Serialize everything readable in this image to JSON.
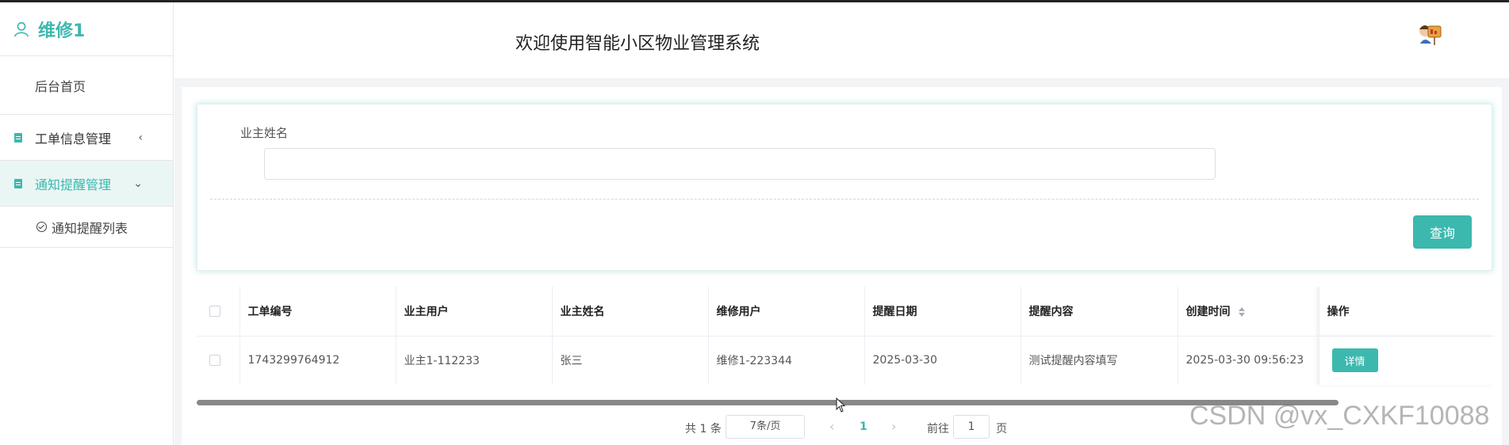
{
  "sidebar": {
    "username": "维修1",
    "items": [
      {
        "label": "后台首页"
      },
      {
        "label": "工单信息管理",
        "arrow": "‹"
      },
      {
        "label": "通知提醒管理",
        "arrow": "⌄"
      }
    ],
    "subitems": [
      {
        "label": "通知提醒列表"
      }
    ]
  },
  "header": {
    "title": "欢迎使用智能小区物业管理系统"
  },
  "search": {
    "label": "业主姓名",
    "value": "",
    "button": "查询"
  },
  "table": {
    "columns": [
      "工单编号",
      "业主用户",
      "业主姓名",
      "维修用户",
      "提醒日期",
      "提醒内容",
      "创建时间",
      "操作"
    ],
    "rows": [
      {
        "c0": "1743299764912",
        "c1": "业主1-112233",
        "c2": "张三",
        "c3": "维修1-223344",
        "c4": "2025-03-30",
        "c5": "测试提醒内容填写",
        "c6": "2025-03-30 09:56:23",
        "action": "详情"
      }
    ]
  },
  "pager": {
    "total": "共 1 条",
    "size": "7条/页",
    "current": "1",
    "goto_label": "前往",
    "goto_value": "1",
    "unit": "页"
  },
  "watermark": "CSDN @vx_CXKF10088",
  "colors": {
    "accent": "#3cb8ae"
  }
}
